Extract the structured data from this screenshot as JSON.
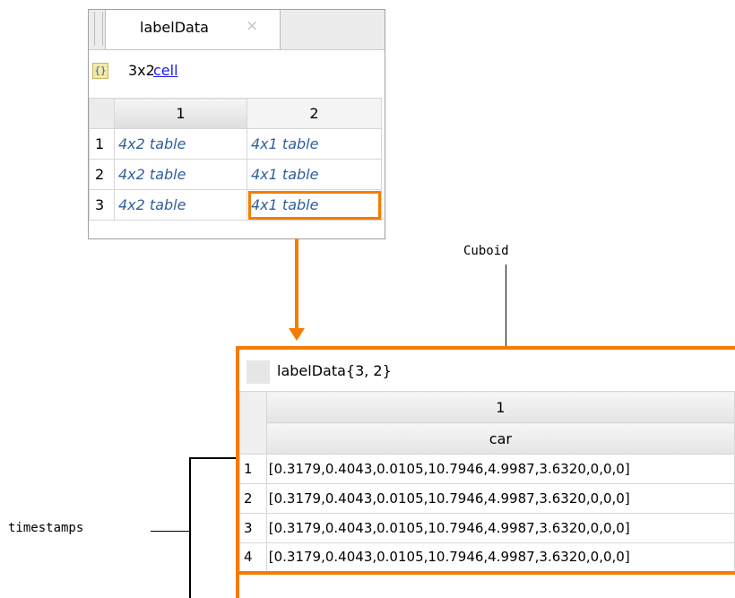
{
  "top_panel": {
    "tab_title": "labelData",
    "close_glyph": "×",
    "variable_icon": "cell-brace-icon",
    "variable_icon_glyph": "{}",
    "variable_size": "3x2",
    "variable_class": "cell",
    "columns": [
      "1",
      "2"
    ],
    "rows": [
      {
        "index": "1",
        "values": [
          "4x2 table",
          "4x1 table"
        ]
      },
      {
        "index": "2",
        "values": [
          "4x2 table",
          "4x1 table"
        ]
      },
      {
        "index": "3",
        "values": [
          "4x2 table",
          "4x1 table"
        ]
      }
    ],
    "selected_cell": {
      "row": "3",
      "column": "2"
    }
  },
  "callouts": {
    "cuboid": "Cuboid",
    "timestamps": "timestamps"
  },
  "bottom_panel": {
    "title": "labelData{3, 2}",
    "column_index": "1",
    "column_name": "car",
    "rows": [
      {
        "index": "1",
        "value": "[0.3179,0.4043,0.0105,10.7946,4.9987,3.6320,0,0,0]"
      },
      {
        "index": "2",
        "value": "[0.3179,0.4043,0.0105,10.7946,4.9987,3.6320,0,0,0]"
      },
      {
        "index": "3",
        "value": "[0.3179,0.4043,0.0105,10.7946,4.9987,3.6320,0,0,0]"
      },
      {
        "index": "4",
        "value": "[0.3179,0.4043,0.0105,10.7946,4.9987,3.6320,0,0,0]"
      }
    ]
  },
  "colors": {
    "highlight": "#f57c00",
    "link": "#1a1aee",
    "cell_text": "#2f5f9e"
  }
}
